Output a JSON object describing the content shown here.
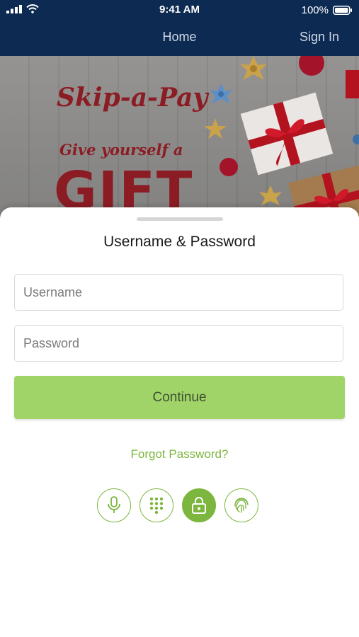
{
  "status_bar": {
    "time": "9:41 AM",
    "battery": "100%"
  },
  "nav": {
    "home": "Home",
    "sign_in": "Sign In"
  },
  "banner": {
    "title": "Skip-a-Pay",
    "subtitle": "Give yourself a",
    "headline": "GIFT"
  },
  "login": {
    "title": "Username & Password",
    "username_placeholder": "Username",
    "username_value": "",
    "password_placeholder": "Password",
    "password_value": "",
    "continue_label": "Continue",
    "forgot_label": "Forgot Password?"
  },
  "auth_methods": [
    {
      "icon": "microphone-icon",
      "active": false
    },
    {
      "icon": "keypad-icon",
      "active": false
    },
    {
      "icon": "lock-icon",
      "active": true
    },
    {
      "icon": "fingerprint-icon",
      "active": false
    }
  ],
  "colors": {
    "header": "#0d2a52",
    "accent": "#7cb63e",
    "button": "#a0d468",
    "banner_text": "#8c1c24"
  }
}
